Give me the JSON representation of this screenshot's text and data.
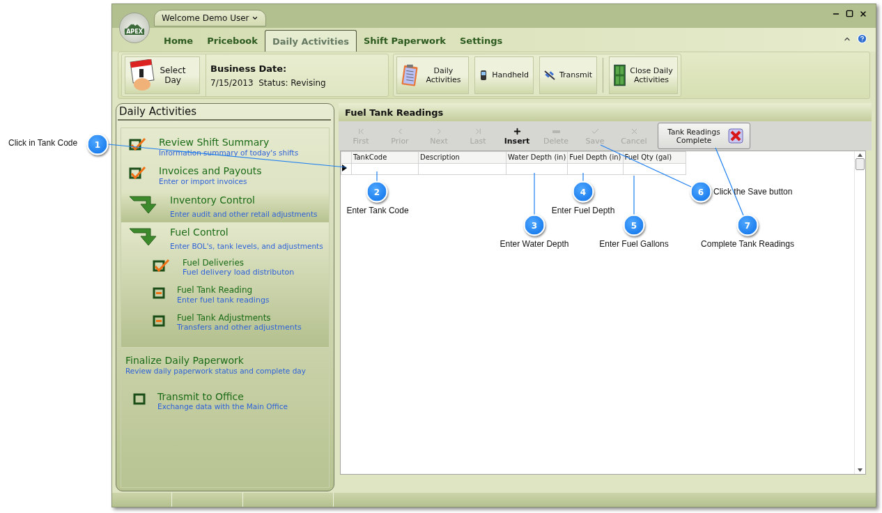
{
  "window": {
    "logo_text": "APEX",
    "user_menu": "Welcome Demo User"
  },
  "tabs": [
    {
      "label": "Home",
      "selected": false
    },
    {
      "label": "Pricebook",
      "selected": false
    },
    {
      "label": "Daily Activities",
      "selected": true
    },
    {
      "label": "Shift Paperwork",
      "selected": false
    },
    {
      "label": "Settings",
      "selected": false
    }
  ],
  "ribbon": {
    "select_day": "Select Day",
    "business_date": {
      "title": "Business Date:",
      "date": "7/15/2013",
      "status": "Status: Revising"
    },
    "buttons": [
      {
        "kind": "clipboard",
        "label": "Daily Activities"
      },
      {
        "kind": "handheld",
        "label": "Handheld"
      },
      {
        "kind": "satellite",
        "label": "Transmit"
      },
      {
        "kind": "door",
        "label": "Close Daily Activities"
      }
    ]
  },
  "sidebar": {
    "title": "Daily Activities",
    "items": [
      {
        "kind": "checked",
        "title": "Review Shift Summary",
        "subtitle": "Information summary of today's shifts",
        "selected": false
      },
      {
        "kind": "checked",
        "title": "Invoices and Payouts",
        "subtitle": "Enter or import invoices",
        "selected": false
      },
      {
        "kind": "group",
        "title": "Inventory Control",
        "subtitle": "Enter audit and other retail adjustments",
        "selected": true
      },
      {
        "kind": "group",
        "title": "Fuel Control",
        "subtitle": "Enter BOL's, tank levels, and adjustments",
        "selected": false,
        "children": [
          {
            "kind": "checked",
            "title": "Fuel Deliveries",
            "subtitle": "Fuel delivery load distributon",
            "selected": false
          },
          {
            "kind": "pending",
            "title": "Fuel Tank Reading",
            "subtitle": "Enter fuel tank readings",
            "selected": false
          },
          {
            "kind": "pending",
            "title": "Fuel Tank Adjustments",
            "subtitle": "Transfers and other adjustments",
            "selected": false
          }
        ]
      }
    ],
    "section": {
      "title": "Finalize Daily Paperwork",
      "subtitle": "Review daily paperwork status and complete day",
      "items": [
        {
          "kind": "unchecked",
          "title": "Transmit to Office",
          "subtitle": "Exchange data with the Main Office",
          "selected": false
        }
      ]
    }
  },
  "main": {
    "title": "Fuel Tank Readings",
    "toolbar": [
      {
        "label": "First",
        "disabled": true
      },
      {
        "label": "Prior",
        "disabled": true
      },
      {
        "label": "Next",
        "disabled": true
      },
      {
        "label": "Last",
        "disabled": true
      },
      {
        "label": "Insert",
        "disabled": false
      },
      {
        "label": "Delete",
        "disabled": true
      },
      {
        "label": "Save",
        "disabled": true
      },
      {
        "label": "Cancel",
        "disabled": true
      }
    ],
    "complete_button": "Tank Readings Complete",
    "grid": {
      "columns": [
        "TankCode",
        "Description",
        "Water Depth (in)",
        "Fuel Depth (in)",
        "Fuel Qty (gal)"
      ],
      "rows": [
        {
          "current": true
        }
      ]
    }
  },
  "annotations": [
    {
      "number": "1",
      "text": "Click in Tank Code"
    },
    {
      "number": "2",
      "text": "Enter Tank Code"
    },
    {
      "number": "3",
      "text": "Enter Water Depth"
    },
    {
      "number": "4",
      "text": "Enter Fuel Depth"
    },
    {
      "number": "5",
      "text": "Enter Fuel Gallons"
    },
    {
      "number": "6",
      "text": "Click the Save button"
    },
    {
      "number": "7",
      "text": "Complete Tank Readings"
    }
  ]
}
